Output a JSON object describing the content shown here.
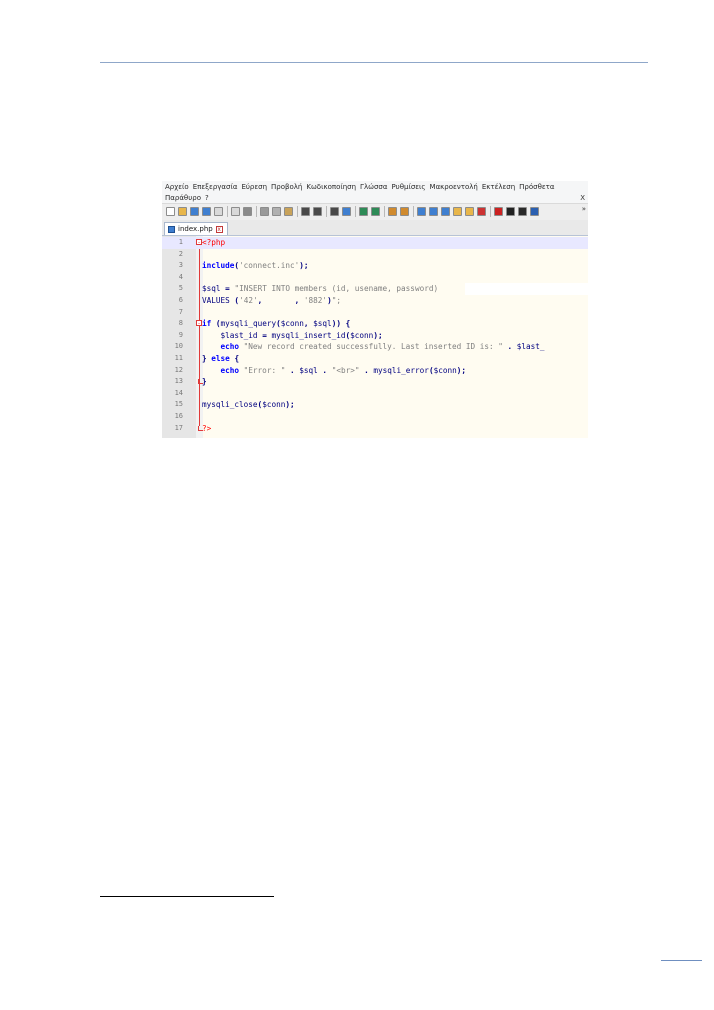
{
  "menubar": {
    "row1": [
      "Αρχείο",
      "Επεξεργασία",
      "Εύρεση",
      "Προβολή",
      "Κωδικοποίηση",
      "Γλώσσα",
      "Ρυθμίσεις",
      "Μακροεντολή",
      "Εκτέλεση",
      "Πρόσθετα"
    ],
    "row2": [
      "Παράθυρο",
      "?"
    ],
    "close": "X"
  },
  "toolbar": {
    "more": "»"
  },
  "tab": {
    "label": "index.php",
    "close_glyph": "x"
  },
  "code": {
    "lines": [
      {
        "n": "1",
        "text": "<?php"
      },
      {
        "n": "2",
        "text": ""
      },
      {
        "n": "3",
        "text": "include('connect.inc');"
      },
      {
        "n": "4",
        "text": ""
      },
      {
        "n": "5",
        "text": "$sql = \"INSERT INTO members (id, usename, password)"
      },
      {
        "n": "6",
        "text": "VALUES ('42',       , '882')\";"
      },
      {
        "n": "7",
        "text": ""
      },
      {
        "n": "8",
        "text": "if (mysqli_query($conn, $sql)) {"
      },
      {
        "n": "9",
        "text": "    $last_id = mysqli_insert_id($conn);"
      },
      {
        "n": "10",
        "text": "    echo \"New record created successfully. Last inserted ID is: \" . $last_"
      },
      {
        "n": "11",
        "text": "} else {"
      },
      {
        "n": "12",
        "text": "    echo \"Error: \" . $sql . \"<br>\" . mysqli_error($conn);"
      },
      {
        "n": "13",
        "text": "}"
      },
      {
        "n": "14",
        "text": ""
      },
      {
        "n": "15",
        "text": "mysqli_close($conn);"
      },
      {
        "n": "16",
        "text": ""
      },
      {
        "n": "17",
        "text": "?>"
      }
    ]
  },
  "colors": {
    "keyword": "#0000ff",
    "string": "#808080",
    "php_tag": "#ff0000",
    "variable": "#000080",
    "function": "#000080",
    "operator": "#000080"
  }
}
